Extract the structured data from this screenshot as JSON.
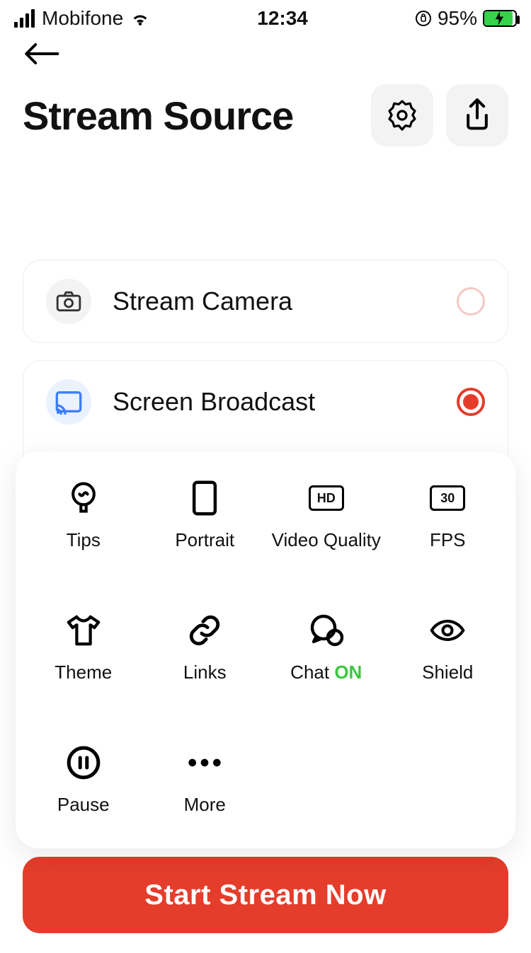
{
  "status": {
    "carrier": "Mobifone",
    "time": "12:34",
    "battery_pct": "95%"
  },
  "header": {
    "title": "Stream Source"
  },
  "sources": {
    "camera": {
      "label": "Stream Camera"
    },
    "broadcast": {
      "label": "Screen Broadcast"
    }
  },
  "tiles": {
    "tips": "Tips",
    "portrait": "Portrait",
    "video_quality": "Video Quality",
    "video_quality_badge": "HD",
    "fps": "FPS",
    "fps_badge": "30",
    "theme": "Theme",
    "links": "Links",
    "chat": "Chat",
    "chat_state": "ON",
    "shield": "Shield",
    "pause": "Pause",
    "more": "More"
  },
  "cta": {
    "label": "Start Stream Now"
  }
}
